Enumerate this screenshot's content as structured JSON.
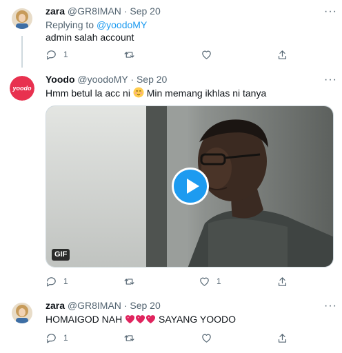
{
  "tweets": [
    {
      "name": "zara",
      "handle": "@GR8IMAN",
      "date": "Sep 20",
      "replying_prefix": "Replying to",
      "replying_handle": "@yoodoMY",
      "text": "admin salah account",
      "reply_count": "1"
    },
    {
      "name": "Yoodo",
      "handle": "@yoodoMY",
      "date": "Sep 20",
      "text_before_emoji": "Hmm betul la acc ni",
      "text_after_emoji": "Min memang ikhlas ni tanya",
      "avatar_text": "yoodo",
      "gif_label": "GIF",
      "reply_count": "1",
      "like_count": "1"
    },
    {
      "name": "zara",
      "handle": "@GR8IMAN",
      "date": "Sep 20",
      "text_before_hearts": "HOMAIGOD NAH",
      "text_after_hearts": "SAYANG YOODO",
      "reply_count": "1"
    }
  ],
  "separator": "·",
  "more_glyph": "···",
  "colors": {
    "brand_yoodo": "#e8314f",
    "link": "#1d9bf0",
    "muted": "#536471",
    "heart": "#e0245e"
  },
  "icons": [
    "reply-icon",
    "retweet-icon",
    "like-icon",
    "share-icon",
    "more-icon",
    "play-icon",
    "blush-emoji",
    "heart-emoji"
  ]
}
